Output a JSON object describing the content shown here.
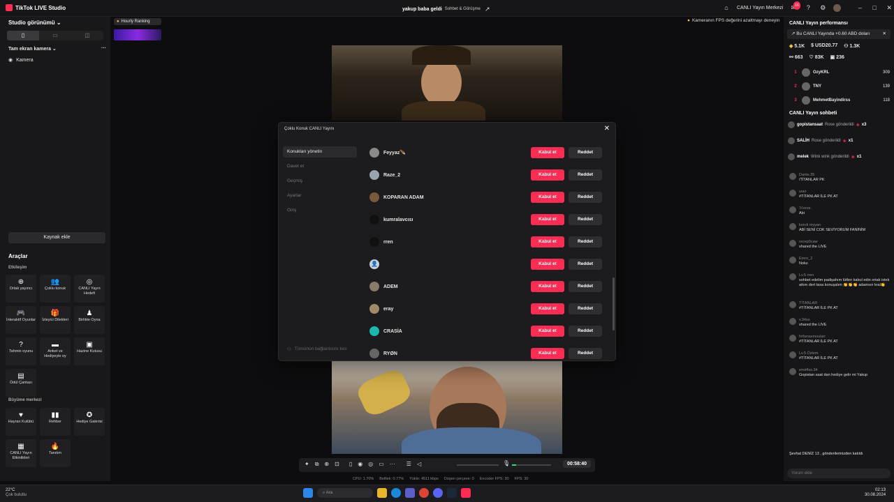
{
  "titlebar": {
    "app_name": "TikTok LIVE Studio",
    "stream_title": "yakup baba geldi",
    "stream_category": "Sohbet & Görüşme",
    "live_center": "CANLI Yayın Merkezi",
    "notif_count": "16"
  },
  "left": {
    "studio_view": "Studio görünümü",
    "scene": "Tam ekran kamera",
    "source_camera": "Kamera",
    "add_source": "Kaynak ekle",
    "tools": "Araçlar",
    "engagement": "Etkileşim",
    "growth": "Büyüme merkezi",
    "engagement_tiles": [
      {
        "icon": "cohost-icon",
        "glyph": "⊕",
        "label": "Ortak yayıncı"
      },
      {
        "icon": "multi-guest-icon",
        "glyph": "👥",
        "label": "Çoklu konuk"
      },
      {
        "icon": "live-goal-icon",
        "glyph": "◎",
        "label": "CANLI Yayın Hedefi"
      },
      {
        "icon": "interactive-games-icon",
        "glyph": "🎮",
        "label": "İnteraktif Oyunlar"
      },
      {
        "icon": "viewer-wishes-icon",
        "glyph": "🎁",
        "label": "İzleyici Dilekleri"
      },
      {
        "icon": "play-together-icon",
        "glyph": "♟",
        "label": "Birlikte Oyna"
      },
      {
        "icon": "prediction-icon",
        "glyph": "?",
        "label": "Tahmin oyunu"
      },
      {
        "icon": "poll-icon",
        "glyph": "▬",
        "label": "Anket ve Hediyeyle oy"
      },
      {
        "icon": "treasure-box-icon",
        "glyph": "▣",
        "label": "Hazine Kutusu"
      },
      {
        "icon": "reward-bag-icon",
        "glyph": "▤",
        "label": "Ödül Çantası"
      }
    ],
    "growth_tiles": [
      {
        "icon": "fan-club-icon",
        "glyph": "♥",
        "label": "Hayran Kulübü"
      },
      {
        "icon": "guide-icon",
        "glyph": "▮▮",
        "label": "Rehber"
      },
      {
        "icon": "gift-gallery-icon",
        "glyph": "✪",
        "label": "Hediye Galerisi"
      },
      {
        "icon": "live-events-icon",
        "glyph": "▦",
        "label": "CANLI Yayın Etkinlikleri"
      },
      {
        "icon": "promote-icon",
        "glyph": "🔥",
        "label": "Tanıtım"
      }
    ]
  },
  "canvas": {
    "hourly_ranking": "Hourly Ranking",
    "fps_tip": "Kameranın FPS değerini azaltmayı deneyin",
    "timer": "00:58:40",
    "stats": [
      "CPU: 1.70%",
      "Belllek: 0.77%",
      "Yükle: 4511 kbps",
      "Düşen çerçeve: 0",
      "Encoder FPS: 30",
      "FPS: 30"
    ]
  },
  "modal": {
    "title": "Çoklu Konuk CANLI Yayını",
    "nav": [
      "Konukları yönetin",
      "Davet et",
      "Geçmiş",
      "Ayarlar",
      "Giriş"
    ],
    "disconnect": "Tümünün bağlantısını kes",
    "accept": "Kabul et",
    "reject": "Reddet",
    "guests": [
      {
        "name": "Feyyaz🪶",
        "color": "#8a8a8a"
      },
      {
        "name": "Raze_2",
        "color": "#9aa3b0"
      },
      {
        "name": "KOPARAN ADAM",
        "color": "#7a5a3a"
      },
      {
        "name": "kumralavcısı",
        "color": "#111111"
      },
      {
        "name": "rren",
        "color": "#111111"
      },
      {
        "name": "",
        "color": "#cfcfcf"
      },
      {
        "name": "ADEM",
        "color": "#8a7a6a"
      },
      {
        "name": "eray",
        "color": "#a08a6a"
      },
      {
        "name": "CRASİA",
        "color": "#1bb8b0"
      },
      {
        "name": "RYØN",
        "color": "#666666"
      }
    ]
  },
  "right": {
    "performance_title": "CANLI Yayın performansı",
    "earning": "Bu CANLI Yayında +0.60 ABD doları",
    "stats1": [
      "5.1K",
      "USD20.77",
      "1.3K"
    ],
    "stats2": [
      "663",
      "83K",
      "236"
    ],
    "ranking": [
      {
        "rank": "1",
        "name": "OzyKRL",
        "score": "309"
      },
      {
        "rank": "2",
        "name": "TNY",
        "score": "139"
      },
      {
        "rank": "3",
        "name": "MehmetBayindirss",
        "score": "118"
      }
    ],
    "chat_title": "CANLI Yayın sohbeti",
    "gifts": [
      {
        "user": "gopistansaat",
        "text": "Rose gönderildi",
        "count": "x3"
      },
      {
        "user": "SALİH",
        "text": "Rose gönderildi",
        "count": "x1"
      },
      {
        "user": "melek",
        "text": "Wink wink gönderildi",
        "count": "x1"
      }
    ],
    "chat": [
      {
        "who": "Dante.35",
        "msg": "/TİTANLAR PK"
      },
      {
        "who": "user",
        "msg": "#TİTANLAR İLE PK AT"
      },
      {
        "who": "ℳerve.",
        "msg": "Abi"
      },
      {
        "who": "koroli reyyan",
        "msg": "ABİ SENİ COK SEVİYORUM FANİNİM"
      },
      {
        "who": "recep0caw",
        "msg": "shared the LIVE"
      },
      {
        "who": "Emre_2",
        "msg": "Noluı"
      },
      {
        "who": "Lv.5 rren",
        "msg": "sohbet edelim padişahım lütfen kabul edin ortak istek attım dert tasa konuşalım 👏👏👏 adamsın kral👏"
      },
      {
        "who": "TİTANLAR",
        "msg": "#TİTANLAR İLE PK AT"
      },
      {
        "who": "v.34ss",
        "msg": "shared the LIVE"
      },
      {
        "who": "fırtlanasmoulan",
        "msg": "#TİTANLAR İLE PK AT"
      },
      {
        "who": "Lv.5 Özlem",
        "msg": "#TİTANLAR İLE PK AT"
      },
      {
        "who": "emirfiss.34",
        "msg": "Gopistan saat dan hediye gelir mi Yakup"
      }
    ],
    "joined": "Şevhat DENİZ 13 , gönderilerinizden katıldı",
    "comment_placeholder": "Yorum ekle"
  },
  "taskbar": {
    "temp": "22°C",
    "weather": "Çok bulutlu",
    "search": "Ara",
    "time": "02:13",
    "date": "30.08.2024"
  },
  "colors": {
    "accent": "#fe2c55",
    "bg": "#0d0d0f",
    "panel": "#18181a"
  }
}
